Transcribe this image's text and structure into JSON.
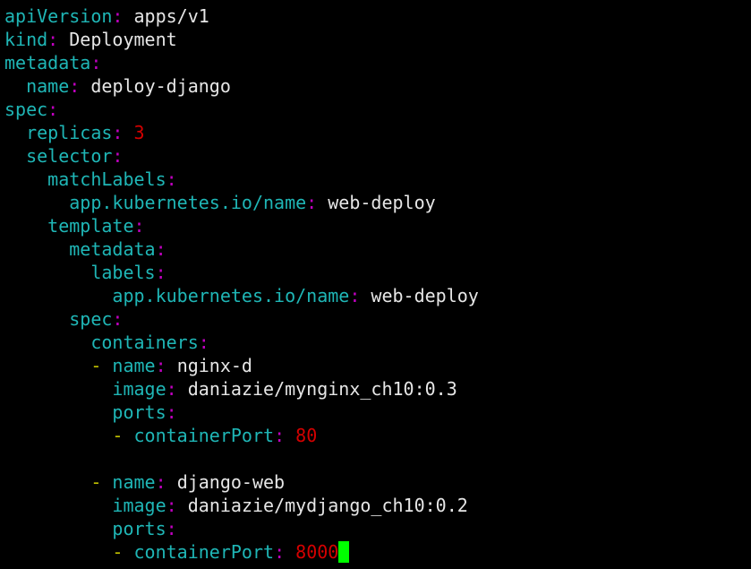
{
  "colors": {
    "background": "#000000",
    "key": "#1fb6b6",
    "colon": "#c000c0",
    "value": "#e6e6e6",
    "number": "#d40000",
    "dash": "#c0c000",
    "cursor": "#00ff00"
  },
  "lines": [
    {
      "indent": "",
      "key": "apiVersion",
      "value": "apps/v1"
    },
    {
      "indent": "",
      "key": "kind",
      "value": "Deployment"
    },
    {
      "indent": "",
      "key": "metadata",
      "value": ""
    },
    {
      "indent": "  ",
      "key": "name",
      "value": "deploy-django"
    },
    {
      "indent": "",
      "key": "spec",
      "value": ""
    },
    {
      "indent": "  ",
      "key": "replicas",
      "value": "3",
      "numeric": true
    },
    {
      "indent": "  ",
      "key": "selector",
      "value": ""
    },
    {
      "indent": "    ",
      "key": "matchLabels",
      "value": ""
    },
    {
      "indent": "      ",
      "key": "app.kubernetes.io/name",
      "value": "web-deploy"
    },
    {
      "indent": "    ",
      "key": "template",
      "value": ""
    },
    {
      "indent": "      ",
      "key": "metadata",
      "value": ""
    },
    {
      "indent": "        ",
      "key": "labels",
      "value": ""
    },
    {
      "indent": "          ",
      "key": "app.kubernetes.io/name",
      "value": "web-deploy"
    },
    {
      "indent": "      ",
      "key": "spec",
      "value": ""
    },
    {
      "indent": "        ",
      "key": "containers",
      "value": ""
    },
    {
      "indent": "        ",
      "dash": "- ",
      "key": "name",
      "value": "nginx-d"
    },
    {
      "indent": "          ",
      "key": "image",
      "value": "daniazie/mynginx_ch10:0.3"
    },
    {
      "indent": "          ",
      "key": "ports",
      "value": ""
    },
    {
      "indent": "          ",
      "dash": "- ",
      "key": "containerPort",
      "value": "80",
      "numeric": true
    },
    {
      "blank": true
    },
    {
      "indent": "        ",
      "dash": "- ",
      "key": "name",
      "value": "django-web"
    },
    {
      "indent": "          ",
      "key": "image",
      "value": "daniazie/mydjango_ch10:0.2"
    },
    {
      "indent": "          ",
      "key": "ports",
      "value": ""
    },
    {
      "indent": "          ",
      "dash": "- ",
      "key": "containerPort",
      "value": "8000",
      "numeric": true,
      "cursor": true
    }
  ]
}
